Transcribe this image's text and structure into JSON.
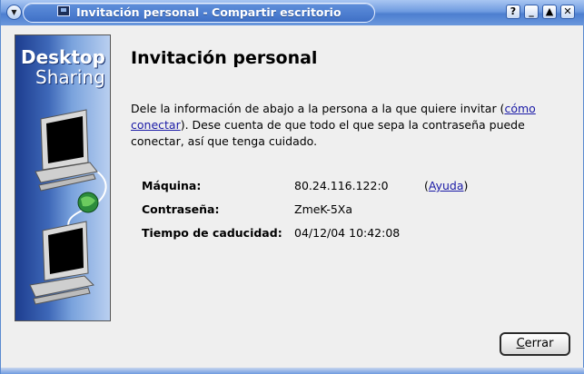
{
  "window": {
    "title": "Invitación personal - Compartir escritorio",
    "controls": [
      "?",
      "_",
      "▲",
      "✕"
    ]
  },
  "banner": {
    "line1": "Desktop",
    "line2": "Sharing"
  },
  "heading": "Invitación personal",
  "description": {
    "part1": "Dele la información de abajo a la persona a la que quiere invitar (",
    "link": "cómo conectar",
    "part2": "). Dese cuenta de que todo el que sepa la contraseña puede conectar, así que tenga cuidado."
  },
  "details": [
    {
      "label": "Máquina:",
      "value": "80.24.116.122:0"
    },
    {
      "label": "Contraseña:",
      "value": "ZmeK-5Xa"
    },
    {
      "label": "Tiempo de caducidad:",
      "value": "04/12/04 10:42:08"
    }
  ],
  "help": {
    "open": "(",
    "link": "Ayuda",
    "close": ")"
  },
  "buttons": {
    "close_access": "C",
    "close_rest": "errar"
  },
  "colors": {
    "titlebar": "#4d7fd0",
    "link": "#1a1aa6",
    "background": "#efefef"
  }
}
